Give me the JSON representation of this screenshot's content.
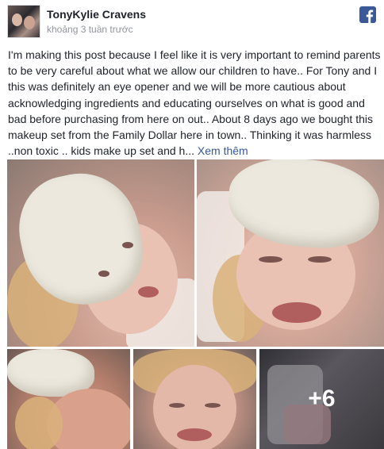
{
  "post": {
    "author": "TonyKylie Cravens",
    "timestamp": "khoảng 3 tuần trước",
    "body_text": "I'm making this post because I feel like it is very important to remind parents to be very careful about what we allow our children to have.. For Tony and I this was definitely an eye opener and we will be more cautious about acknowledging ingredients and educating ourselves on what is good and bad before purchasing from here on out.. About 8 days ago we bought this makeup set from the Family Dollar here in town.. Thinking it was harmless ..non toxic .. kids make up set and h...",
    "see_more_label": "Xem thêm",
    "photos": {
      "more_count_label": "+6"
    }
  },
  "icons": {
    "source": "facebook-icon",
    "avatar": "profile-avatar"
  },
  "colors": {
    "link": "#365899",
    "facebook_blue": "#3b5998",
    "meta_text": "#90949c"
  }
}
